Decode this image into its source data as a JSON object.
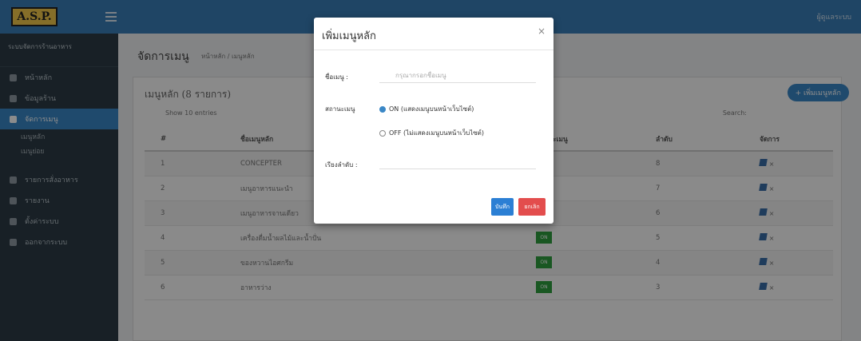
{
  "topbar": {
    "logo": "A.S.P.",
    "user": "ผู้ดูแลระบบ"
  },
  "sidebar": {
    "header": "ระบบจัดการร้านอาหาร",
    "items": [
      {
        "label": "หน้าหลัก"
      },
      {
        "label": "ข้อมูลร้าน"
      },
      {
        "label": "จัดการเมนู",
        "active": true
      }
    ],
    "subs": [
      "เมนูหลัก",
      "เมนูย่อย"
    ],
    "items2": [
      {
        "label": "รายการสั่งอาหาร"
      },
      {
        "label": "รายงาน"
      },
      {
        "label": "ตั้งค่าระบบ"
      },
      {
        "label": "ออกจากระบบ"
      }
    ]
  },
  "content": {
    "title": "จัดการเมนู",
    "breadcrumb": "หน้าหลัก / เมนูหลัก",
    "card_title": "เมนูหลัก (8 รายการ)",
    "add_button": "+ เพิ่มเมนูหลัก",
    "show": "Show 10 entries",
    "search": "Search:",
    "columns": [
      "#",
      "ชื่อเมนูหลัก",
      "สถานะเมนู",
      "ลำดับ",
      "จัดการ"
    ],
    "rows": [
      {
        "no": "1",
        "name": "CONCEPTER",
        "status": "ON",
        "order": "8"
      },
      {
        "no": "2",
        "name": "เมนูอาหารแนะนำ",
        "status": "ON",
        "order": "7"
      },
      {
        "no": "3",
        "name": "เมนูอาหารจานเดียว",
        "status": "ON",
        "order": "6"
      },
      {
        "no": "4",
        "name": "เครื่องดื่มน้ำผลไม้และน้ำปั่น",
        "status": "ON",
        "order": "5"
      },
      {
        "no": "5",
        "name": "ของหวานไอศกรีม",
        "status": "ON",
        "order": "4"
      },
      {
        "no": "6",
        "name": "อาหารว่าง",
        "status": "ON",
        "order": "3"
      }
    ]
  },
  "modal": {
    "title": "เพิ่มเมนูหลัก",
    "close": "×",
    "name_label": "ชื่อเมนู :",
    "name_placeholder": "กรุณากรอกชื่อเมนู",
    "status_label": "สถานะเมนู",
    "radio_on": "ON (แสดงเมนูบนหน้าเว็บไซต์)",
    "radio_off": "OFF (ไม่แสดงเมนูบนหน้าเว็บไซต์)",
    "order_label": "เรียงลำดับ :",
    "save": "บันทึก",
    "cancel": "ยกเลิก"
  }
}
